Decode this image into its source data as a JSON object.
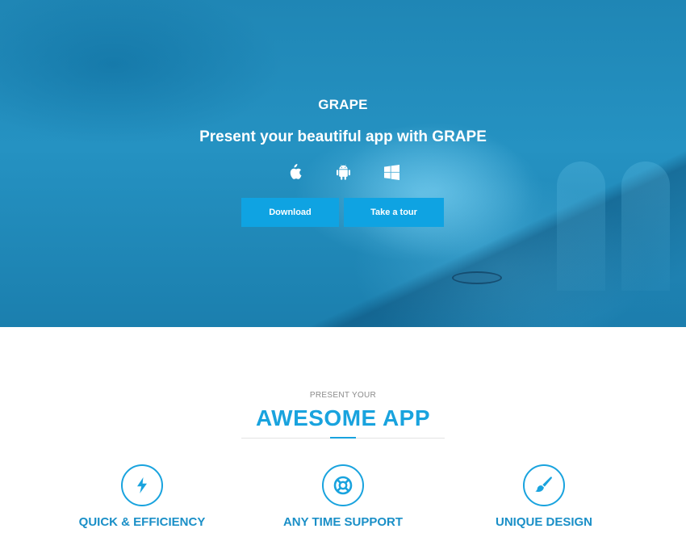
{
  "hero": {
    "brand": "GRAPE",
    "headline": "Present your beautiful app with GRAPE",
    "platforms": [
      "apple-icon",
      "android-icon",
      "windows-icon"
    ],
    "buttons": {
      "download": "Download",
      "tour": "Take a tour"
    }
  },
  "features_section": {
    "kicker": "PRESENT YOUR",
    "title": "AWESOME APP",
    "items": [
      {
        "icon": "lightning-icon",
        "label": "QUICK & EFFICIENCY"
      },
      {
        "icon": "lifebuoy-icon",
        "label": "ANY TIME SUPPORT"
      },
      {
        "icon": "paintbrush-icon",
        "label": "UNIQUE DESIGN"
      }
    ]
  },
  "colors": {
    "accent": "#19a3de",
    "button": "#0fa3e2",
    "hero_bg": "#2592c2"
  }
}
